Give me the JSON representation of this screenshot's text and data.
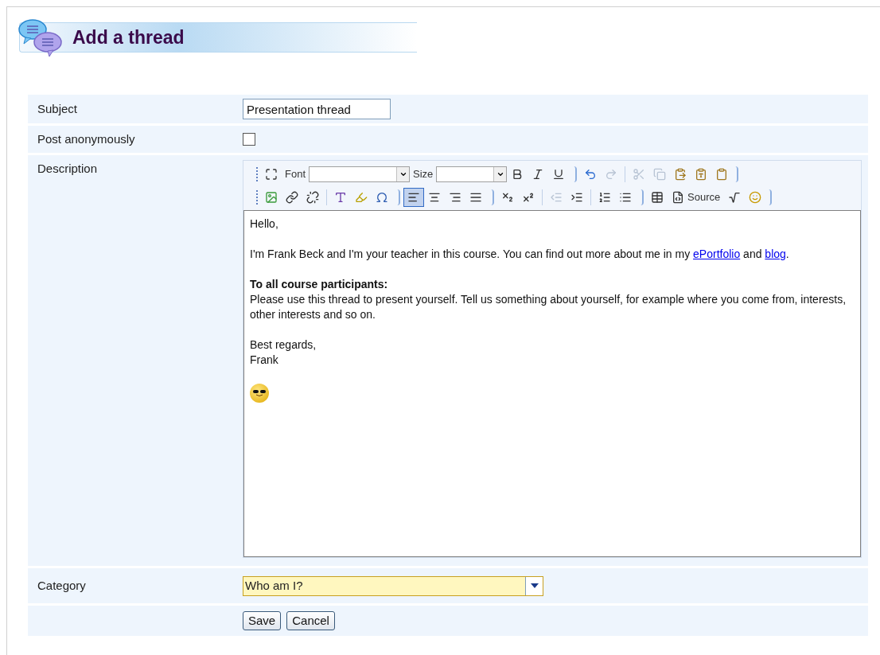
{
  "page_title": "Add a thread",
  "form": {
    "subject": {
      "label": "Subject",
      "value": "Presentation thread"
    },
    "anonymous": {
      "label": "Post anonymously",
      "checked": false
    },
    "description": {
      "label": "Description",
      "toolbar": [
        [
          {
            "kind": "maximize",
            "disabled": false,
            "selected": false
          },
          {
            "kind": "font_label",
            "text": "Font"
          },
          {
            "kind": "font_select"
          },
          {
            "kind": "font_label",
            "text": "Size"
          },
          {
            "kind": "size_select"
          },
          {
            "kind": "bold",
            "disabled": false,
            "selected": false
          },
          {
            "kind": "italic",
            "disabled": false,
            "selected": false
          },
          {
            "kind": "underline",
            "disabled": false,
            "selected": false
          },
          {
            "kind": "sep"
          },
          {
            "kind": "undo",
            "disabled": false,
            "selected": false
          },
          {
            "kind": "redo",
            "disabled": true,
            "selected": false
          },
          {
            "kind": "divider"
          },
          {
            "kind": "cut",
            "disabled": true,
            "selected": false
          },
          {
            "kind": "copy",
            "disabled": true,
            "selected": false
          },
          {
            "kind": "paste",
            "disabled": false,
            "selected": false
          },
          {
            "kind": "paste_text",
            "disabled": false,
            "selected": false
          },
          {
            "kind": "paste_word",
            "disabled": false,
            "selected": false
          },
          {
            "kind": "end"
          }
        ],
        [
          {
            "kind": "image",
            "disabled": false,
            "selected": false
          },
          {
            "kind": "link",
            "disabled": false,
            "selected": false
          },
          {
            "kind": "unlink",
            "disabled": false,
            "selected": false
          },
          {
            "kind": "divider"
          },
          {
            "kind": "text_color",
            "disabled": false,
            "selected": false
          },
          {
            "kind": "highlight",
            "disabled": false,
            "selected": false
          },
          {
            "kind": "omega",
            "disabled": false,
            "selected": false
          },
          {
            "kind": "sep"
          },
          {
            "kind": "align_left",
            "disabled": false,
            "selected": true
          },
          {
            "kind": "align_center",
            "disabled": false,
            "selected": false
          },
          {
            "kind": "align_right",
            "disabled": false,
            "selected": false
          },
          {
            "kind": "justify",
            "disabled": false,
            "selected": false
          },
          {
            "kind": "sep"
          },
          {
            "kind": "subscript",
            "disabled": false,
            "selected": false
          },
          {
            "kind": "superscript",
            "disabled": false,
            "selected": false
          },
          {
            "kind": "divider"
          },
          {
            "kind": "outdent",
            "disabled": true,
            "selected": false
          },
          {
            "kind": "indent",
            "disabled": false,
            "selected": false
          },
          {
            "kind": "divider"
          },
          {
            "kind": "ordered_list",
            "disabled": false,
            "selected": false
          },
          {
            "kind": "bullet_list",
            "disabled": false,
            "selected": false
          },
          {
            "kind": "sep"
          },
          {
            "kind": "table",
            "disabled": false,
            "selected": false
          },
          {
            "kind": "source",
            "text": "Source",
            "disabled": false,
            "selected": false
          },
          {
            "kind": "formula",
            "disabled": false,
            "selected": false
          },
          {
            "kind": "smiley",
            "disabled": false,
            "selected": false
          },
          {
            "kind": "end"
          }
        ]
      ],
      "body": [
        {
          "kind": "text",
          "text": "Hello,"
        },
        {
          "kind": "blank"
        },
        {
          "kind": "rich",
          "parts": [
            {
              "kind": "text",
              "text": "I'm Frank Beck and I'm your teacher in this course. You can find out more about me in my "
            },
            {
              "kind": "link",
              "text": "ePortfolio"
            },
            {
              "kind": "text",
              "text": " and "
            },
            {
              "kind": "link",
              "text": "blog"
            },
            {
              "kind": "text",
              "text": "."
            }
          ]
        },
        {
          "kind": "blank"
        },
        {
          "kind": "bold",
          "text": "To all course participants:"
        },
        {
          "kind": "text",
          "text": "Please use this thread to present yourself. Tell us something about yourself, for example where you come from, interests, other interests and so on."
        },
        {
          "kind": "blank"
        },
        {
          "kind": "text",
          "text": "Best regards,"
        },
        {
          "kind": "text",
          "text": "Frank"
        },
        {
          "kind": "blank"
        },
        {
          "kind": "emoticon"
        }
      ]
    },
    "category": {
      "label": "Category",
      "value": "Who am I?"
    },
    "buttons": [
      {
        "text": "Save"
      },
      {
        "text": "Cancel"
      }
    ]
  }
}
